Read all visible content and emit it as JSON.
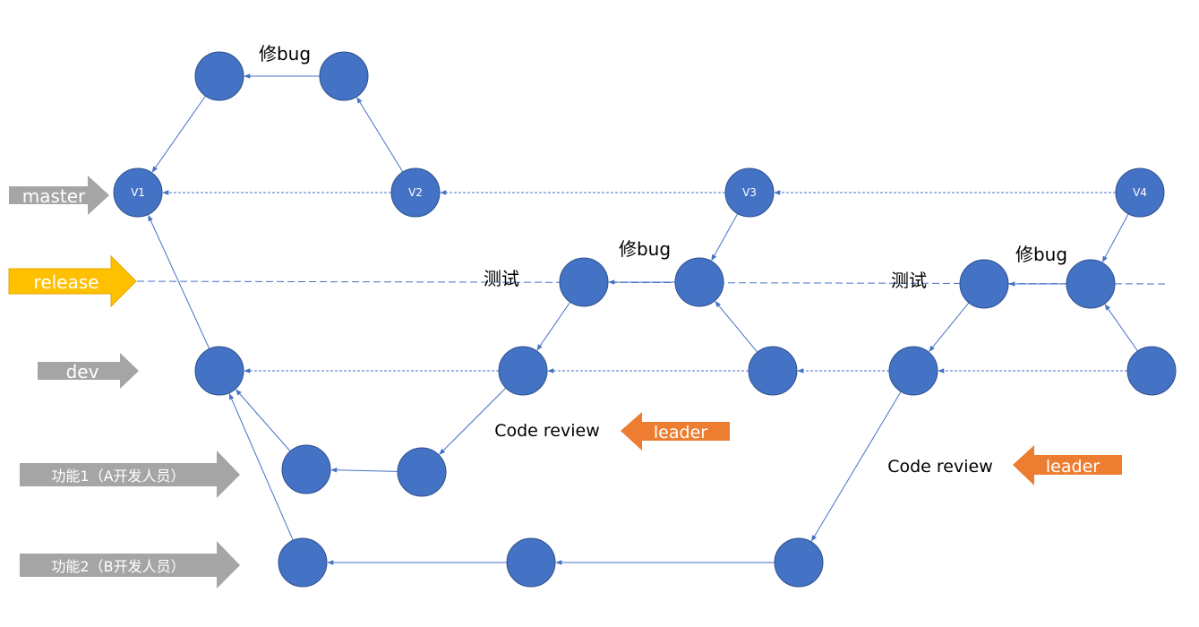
{
  "colors": {
    "node": "#4472C4",
    "edge": "#4472C4",
    "branch_gray": "#A5A5A5",
    "release": "#FFC000",
    "leader": "#ED7D31"
  },
  "branches": {
    "master": "master",
    "release": "release",
    "dev": "dev",
    "feature1": "功能1（A开发人员）",
    "feature2": "功能2（B开发人员）"
  },
  "versions": {
    "v1": "V1",
    "v2": "V2",
    "v3": "V3",
    "v4": "V4"
  },
  "annotations": {
    "fix_bug_1": "修bug",
    "fix_bug_2": "修bug",
    "fix_bug_3": "修bug",
    "test_1": "测试",
    "test_2": "测试",
    "code_review_1": "Code review",
    "code_review_2": "Code review",
    "leader_1": "leader",
    "leader_2": "leader"
  }
}
